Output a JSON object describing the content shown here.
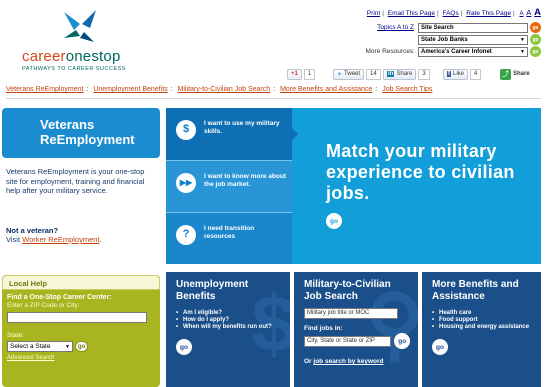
{
  "header": {
    "logo": {
      "name_part1": "career",
      "name_part2": "onestop",
      "tagline": "PATHWAYS TO CAREER SUCCESS"
    },
    "util_links": [
      "Print",
      "Email This Page",
      "FAQs",
      "Rate This Page"
    ],
    "text_size": [
      "A",
      "A",
      "A"
    ],
    "topics_link": "Topics A to Z",
    "site_search": {
      "value": "Site Search"
    },
    "state_job_banks": {
      "value": "State Job Banks"
    },
    "more_resources": {
      "label": "More Resources:",
      "value": "America's Career Infonet"
    },
    "go_label": "go",
    "social": {
      "plusone": "+1",
      "plusone_count": "1",
      "tweet": "Tweet",
      "tweet_count": "14",
      "linkedin_share": "Share",
      "linkedin_count": "3",
      "fb_like": "Like",
      "fb_count": "4",
      "share": "Share"
    }
  },
  "breadcrumb": [
    "Veterans ReEmployment",
    "Unemployment Benefits",
    "Military-to-Civilian Job Search",
    "More Benefits and Assistance",
    "Job Search Tips"
  ],
  "left": {
    "title": "Veterans ReEmployment",
    "description": "Veterans ReEmployment is your one-stop site for employment, training and financial help after your military service.",
    "not_veteran_q": "Not a veteran?",
    "visit_text": "Visit",
    "visit_link": "Worker ReEmployment",
    "visit_end": "."
  },
  "local_help": {
    "header": "Local Help",
    "title": "Find a One-Stop Career Center:",
    "zip_label": "Enter a ZIP Code or City:",
    "state_label": "State:",
    "state_select": "Select a State",
    "go": "go",
    "advanced": "Advanced Search"
  },
  "hero": {
    "tiles": [
      {
        "icon": "$",
        "text": "I want to use my military skills."
      },
      {
        "icon": "▶▶",
        "text": "I want to know more about the job market."
      },
      {
        "icon": "?",
        "text": "I need transition resources"
      }
    ],
    "headline": "Match your military experience to civilian jobs.",
    "go": "go"
  },
  "panels": {
    "unemployment": {
      "title": "Unemployment Benefits",
      "items": [
        "Am I eligible?",
        "How do I apply?",
        "When will my benefits run out?"
      ],
      "go": "go"
    },
    "military": {
      "title": "Military-to-Civilian Job Search",
      "job_input_value": "Military job title or MOC",
      "find_label": "Find jobs in:",
      "location_value": "City, State or State or ZIP",
      "go": "go",
      "or_text": "Or",
      "keyword_link": "job search by keyword"
    },
    "benefits": {
      "title": "More Benefits and Assistance",
      "items": [
        "Health care",
        "Food support",
        "Housing and energy assistance"
      ],
      "go": "go"
    }
  },
  "colors": {
    "brand_orange": "#d4481c",
    "brand_teal": "#00695c",
    "hero_blue": "#129ed8",
    "panel_navy": "#1b4f8a",
    "local_help_olive": "#a8b520"
  }
}
